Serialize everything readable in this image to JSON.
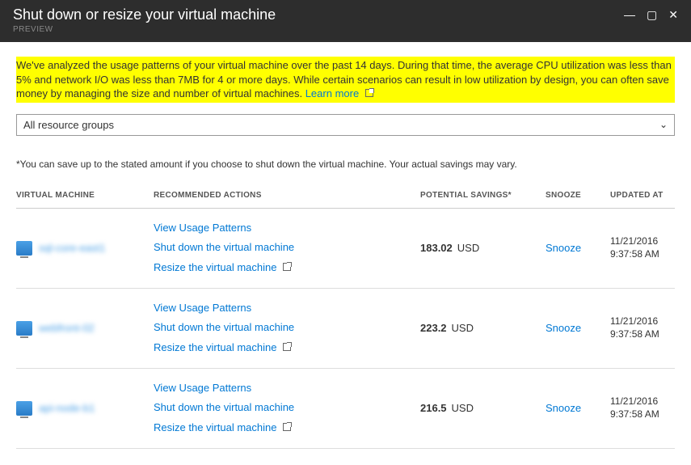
{
  "titlebar": {
    "title": "Shut down or resize your virtual machine",
    "preview": "PREVIEW"
  },
  "analysis_text": "We've analyzed the usage patterns of your virtual machine over the past 14 days. During that time, the average CPU utilization was less than 5% and network I/O was less than 7MB for 4 or more days. While certain scenarios can result in low utilization by design, you can often save money by managing the size and number of virtual machines. ",
  "learn_more": "Learn more",
  "dropdown": {
    "selected": "All resource groups"
  },
  "footnote": "*You can save up to the stated amount if you choose to shut down the virtual machine. Your actual savings may vary.",
  "columns": {
    "vm": "VIRTUAL MACHINE",
    "actions": "RECOMMENDED ACTIONS",
    "savings": "POTENTIAL SAVINGS*",
    "snooze": "SNOOZE",
    "updated": "UPDATED AT"
  },
  "action_labels": {
    "view": "View Usage Patterns",
    "shutdown": "Shut down the virtual machine",
    "resize": "Resize the virtual machine"
  },
  "snooze_label": "Snooze",
  "rows": [
    {
      "vm_name": "sql-core-east1",
      "savings_amount": "183.02",
      "currency": "USD",
      "updated_date": "11/21/2016",
      "updated_time": "9:37:58 AM"
    },
    {
      "vm_name": "webfront-02",
      "savings_amount": "223.2",
      "currency": "USD",
      "updated_date": "11/21/2016",
      "updated_time": "9:37:58 AM"
    },
    {
      "vm_name": "api-node-b1",
      "savings_amount": "216.5",
      "currency": "USD",
      "updated_date": "11/21/2016",
      "updated_time": "9:37:58 AM"
    }
  ]
}
